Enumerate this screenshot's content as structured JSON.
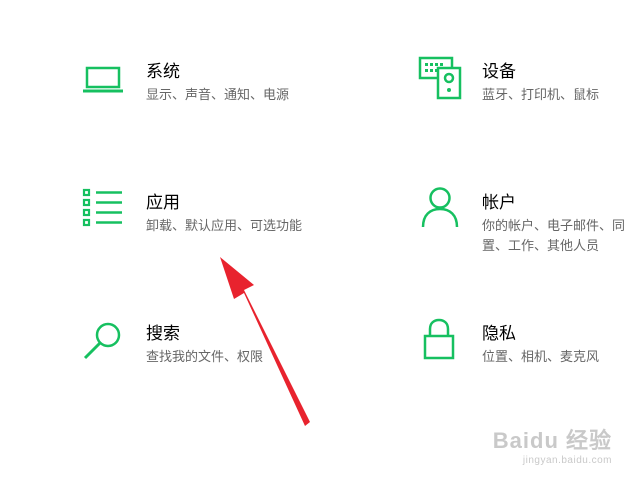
{
  "tiles": [
    {
      "title": "系统",
      "desc": "显示、声音、通知、电源",
      "icon": "laptop-icon"
    },
    {
      "title": "设备",
      "desc": "蓝牙、打印机、鼠标",
      "icon": "devices-icon"
    },
    {
      "title": "应用",
      "desc": "卸载、默认应用、可选功能",
      "icon": "apps-list-icon"
    },
    {
      "title": "帐户",
      "desc_line1": "你的帐户、电子邮件、同",
      "desc_line2": "置、工作、其他人员",
      "icon": "person-icon"
    },
    {
      "title": "搜索",
      "desc": "查找我的文件、权限",
      "icon": "search-icon"
    },
    {
      "title": "隐私",
      "desc": "位置、相机、麦克风",
      "icon": "lock-icon"
    }
  ],
  "accent_color": "#16c060",
  "arrow_color": "#e8232e",
  "watermark": {
    "main": "Baidu 经验",
    "sub": "jingyan.baidu.com"
  }
}
